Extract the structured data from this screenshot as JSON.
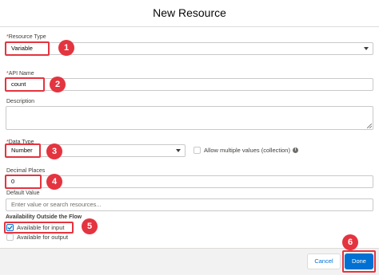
{
  "dialog": {
    "title": "New Resource"
  },
  "form": {
    "resource_type": {
      "label": "Resource Type",
      "value": "Variable"
    },
    "api_name": {
      "label": "API Name",
      "value": "count"
    },
    "description": {
      "label": "Description",
      "value": ""
    },
    "data_type": {
      "label": "Data Type",
      "value": "Number"
    },
    "allow_multiple": {
      "label": "Allow multiple values (collection)",
      "checked": false
    },
    "decimal_places": {
      "label": "Decimal Places",
      "value": "0"
    },
    "default_value": {
      "label": "Default Value",
      "placeholder": "Enter value or search resources..."
    },
    "availability": {
      "title": "Availability Outside the Flow",
      "input": {
        "label": "Available for input",
        "checked": true
      },
      "output": {
        "label": "Available for output",
        "checked": false
      }
    },
    "required_marker": "*"
  },
  "footer": {
    "cancel_label": "Cancel",
    "done_label": "Done"
  },
  "callouts": [
    "1",
    "2",
    "3",
    "4",
    "5",
    "6"
  ],
  "icons": {
    "dropdown": "chevron-down-icon",
    "info": "info-icon",
    "check": "checkmark-icon"
  },
  "colors": {
    "callout": "#e4343f",
    "brand": "#0070d2",
    "footer_bg": "#f3f2f2"
  }
}
